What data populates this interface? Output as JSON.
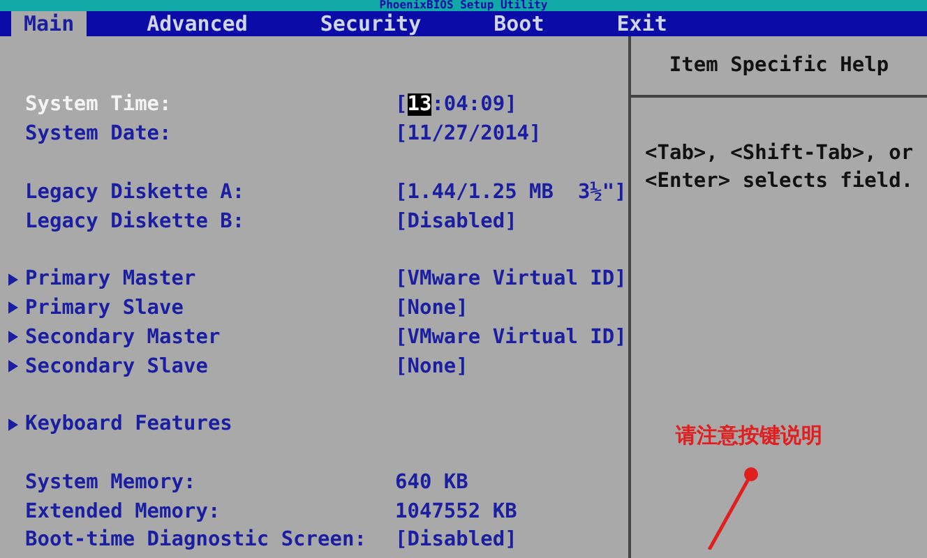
{
  "window": {
    "title": "PhoenixBIOS Setup Utility"
  },
  "tabs": [
    {
      "label": "Main",
      "selected": true
    },
    {
      "label": "Advanced",
      "selected": false
    },
    {
      "label": "Security",
      "selected": false
    },
    {
      "label": "Boot",
      "selected": false
    },
    {
      "label": "Exit",
      "selected": false
    }
  ],
  "groups": [
    {
      "items": [
        {
          "kind": "field",
          "label": "System Time:",
          "selected": true,
          "value_parts": [
            {
              "text": "[",
              "selected": false
            },
            {
              "text": "13",
              "selected": true
            },
            {
              "text": ":04:09]",
              "selected": false
            }
          ]
        },
        {
          "kind": "field",
          "label": "System Date:",
          "selected": false,
          "value_parts": [
            {
              "text": "[11/27/2014]",
              "selected": false
            }
          ]
        }
      ]
    },
    {
      "items": [
        {
          "kind": "field",
          "label": "Legacy Diskette A:",
          "selected": false,
          "value_parts": [
            {
              "text": "[1.44/1.25 MB  3½\"]",
              "selected": false
            }
          ]
        },
        {
          "kind": "field",
          "label": "Legacy Diskette B:",
          "selected": false,
          "value_parts": [
            {
              "text": "[Disabled]",
              "selected": false
            }
          ]
        }
      ]
    },
    {
      "items": [
        {
          "kind": "submenu",
          "label": "Primary Master",
          "selected": false,
          "value_parts": [
            {
              "text": "[VMware Virtual ID]",
              "selected": false
            }
          ]
        },
        {
          "kind": "submenu",
          "label": "Primary Slave",
          "selected": false,
          "value_parts": [
            {
              "text": "[None]",
              "selected": false
            }
          ]
        },
        {
          "kind": "submenu",
          "label": "Secondary Master",
          "selected": false,
          "value_parts": [
            {
              "text": "[VMware Virtual ID]",
              "selected": false
            }
          ]
        },
        {
          "kind": "submenu",
          "label": "Secondary Slave",
          "selected": false,
          "value_parts": [
            {
              "text": "[None]",
              "selected": false
            }
          ]
        }
      ]
    },
    {
      "items": [
        {
          "kind": "submenu",
          "label": "Keyboard Features",
          "selected": false
        }
      ]
    },
    {
      "items": [
        {
          "kind": "field",
          "label": "System Memory:",
          "selected": false,
          "value_parts": [
            {
              "text": "640 KB",
              "selected": false
            }
          ]
        },
        {
          "kind": "field",
          "label": "Extended Memory:",
          "selected": false,
          "value_parts": [
            {
              "text": "1047552 KB",
              "selected": false
            }
          ]
        },
        {
          "kind": "field",
          "label": "Boot-time Diagnostic Screen:",
          "selected": false,
          "value_parts": [
            {
              "text": "[Disabled]",
              "selected": false
            }
          ]
        }
      ]
    }
  ],
  "help": {
    "title": "Item Specific Help",
    "text": "<Tab>, <Shift-Tab>, or <Enter> selects field."
  },
  "annotation": {
    "text": "请注意按键说明"
  }
}
